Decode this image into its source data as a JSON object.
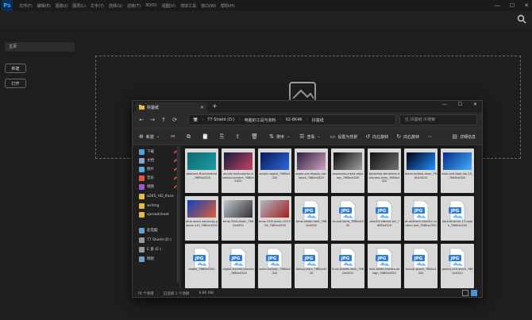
{
  "ps": {
    "logo": "Ps",
    "menu": [
      "文件(F)",
      "编辑(E)",
      "图像(I)",
      "图层(L)",
      "文字(Y)",
      "选择(S)",
      "滤镜(T)",
      "3D(D)",
      "视图(V)",
      "增效工具",
      "窗口(W)",
      "帮助(H)"
    ],
    "home": "主页",
    "new_btn": "新建",
    "open_btn": "打开"
  },
  "fx": {
    "tab_title": "抖楚纸",
    "address": [
      "T7 Shield (D:)",
      "电脑的工具与资料",
      "02-8K4K",
      "抖楚纸"
    ],
    "search_placeholder": "在 抖楚纸 中搜索",
    "cmd": {
      "new": "新建",
      "sort": "排序",
      "view": "查看",
      "set_desktop": "设置为背景",
      "rotate_left": "向左旋转",
      "rotate_right": "向右旋转",
      "details": "详细信息"
    },
    "sidebar": [
      {
        "label": "下载",
        "color": "#4aa3df"
      },
      {
        "label": "文档",
        "color": "#8aa7c9"
      },
      {
        "label": "图片",
        "color": "#5aa9e6"
      },
      {
        "label": "音乐",
        "color": "#e2564b"
      },
      {
        "label": "视频",
        "color": "#9b59d0"
      },
      {
        "label": "a2K5_HD_Iface",
        "color": "#e8b84a"
      },
      {
        "label": "writing",
        "color": "#e8b84a"
      },
      {
        "label": "spreadsheet",
        "color": "#e8b84a"
      },
      {
        "label": "此电脑",
        "color": "#6aa0d8"
      },
      {
        "label": "T7 Shield (D:)",
        "color": "#9a9a9a"
      },
      {
        "label": "E 盘 (E:)",
        "color": "#9a9a9a"
      },
      {
        "label": "网络",
        "color": "#6aa0d8"
      }
    ],
    "files": [
      {
        "name": "abstract-fluid-texture_7680x4320",
        "kind": "img",
        "thumb": [
          "#0e6b74",
          "#1a9ca0"
        ]
      },
      {
        "name": "acrylic-half-colorful-abstract-iphone_7680x4320",
        "kind": "img",
        "thumb": [
          "#1a1a3a",
          "#c44466"
        ]
      },
      {
        "name": "acrylic-space_7680x4320",
        "kind": "img",
        "thumb": [
          "#0a1a5a",
          "#2a6ad8"
        ]
      },
      {
        "name": "apple-pro-display-xdr-stock_7680x4320",
        "kind": "img",
        "thumb": [
          "#302040",
          "#d0a0c0"
        ]
      },
      {
        "name": "assassins-creed-odyssey_7680x4320",
        "kind": "img",
        "thumb": [
          "#0a0a0a",
          "#a0a0a0"
        ]
      },
      {
        "name": "berserker-berserker-darkness-lives_7680x4320",
        "kind": "img",
        "thumb": [
          "#101010",
          "#707070"
        ]
      },
      {
        "name": "black-eclipse-imac_7680x4320",
        "kind": "img",
        "thumb": [
          "#000010",
          "#2090ff"
        ]
      },
      {
        "name": "blue-and-light-ios-13_7680x4320",
        "kind": "img",
        "thumb": [
          "#0a2a8a",
          "#40b0ff"
        ]
      },
      {
        "name": "blue-stock-samsung-galaxy-s10_7680x4320",
        "kind": "img",
        "thumb": [
          "#1040c0",
          "#e06030"
        ]
      },
      {
        "name": "bmw-330i-vision_7680x4320",
        "kind": "img",
        "thumb": [
          "#c0c8d0",
          "#303030"
        ]
      },
      {
        "name": "bmw-330i-vision-2019-5k_7680x4320",
        "kind": "img",
        "thumb": [
          "#b0b8c0",
          "#a02020"
        ]
      },
      {
        "name": "bmw-vision-next_7680x4320",
        "kind": "jpg"
      },
      {
        "name": "cinque-terre_7680x4320",
        "kind": "jpg"
      },
      {
        "name": "colorful-vibrant-art_7680x4320",
        "kind": "jpg"
      },
      {
        "name": "dt-abstract-colorful-surface-line_7680x4320",
        "kind": "jpg"
      },
      {
        "name": "dark-blue-ios-13-apple_7680x4320",
        "kind": "jpg"
      },
      {
        "name": "diablo_7680x4320",
        "kind": "jpg"
      },
      {
        "name": "digital-surreal-planets_7680x4320",
        "kind": "jpg"
      },
      {
        "name": "earth-horizon_7680x4320",
        "kind": "jpg"
      },
      {
        "name": "falling-stars_7680x4320",
        "kind": "jpg"
      },
      {
        "name": "fluid-shades-dark_7680x4320",
        "kind": "jpg"
      },
      {
        "name": "fluid-white-shades-design_7680x4320",
        "kind": "jpg"
      },
      {
        "name": "fractal-space_7680x4320",
        "kind": "jpg"
      },
      {
        "name": "galaxy-s10-stock_7680x4320",
        "kind": "jpg"
      }
    ],
    "status": {
      "count": "76 个项目",
      "selected": "已选择 1 个项目",
      "size": "9.80 MB"
    }
  }
}
